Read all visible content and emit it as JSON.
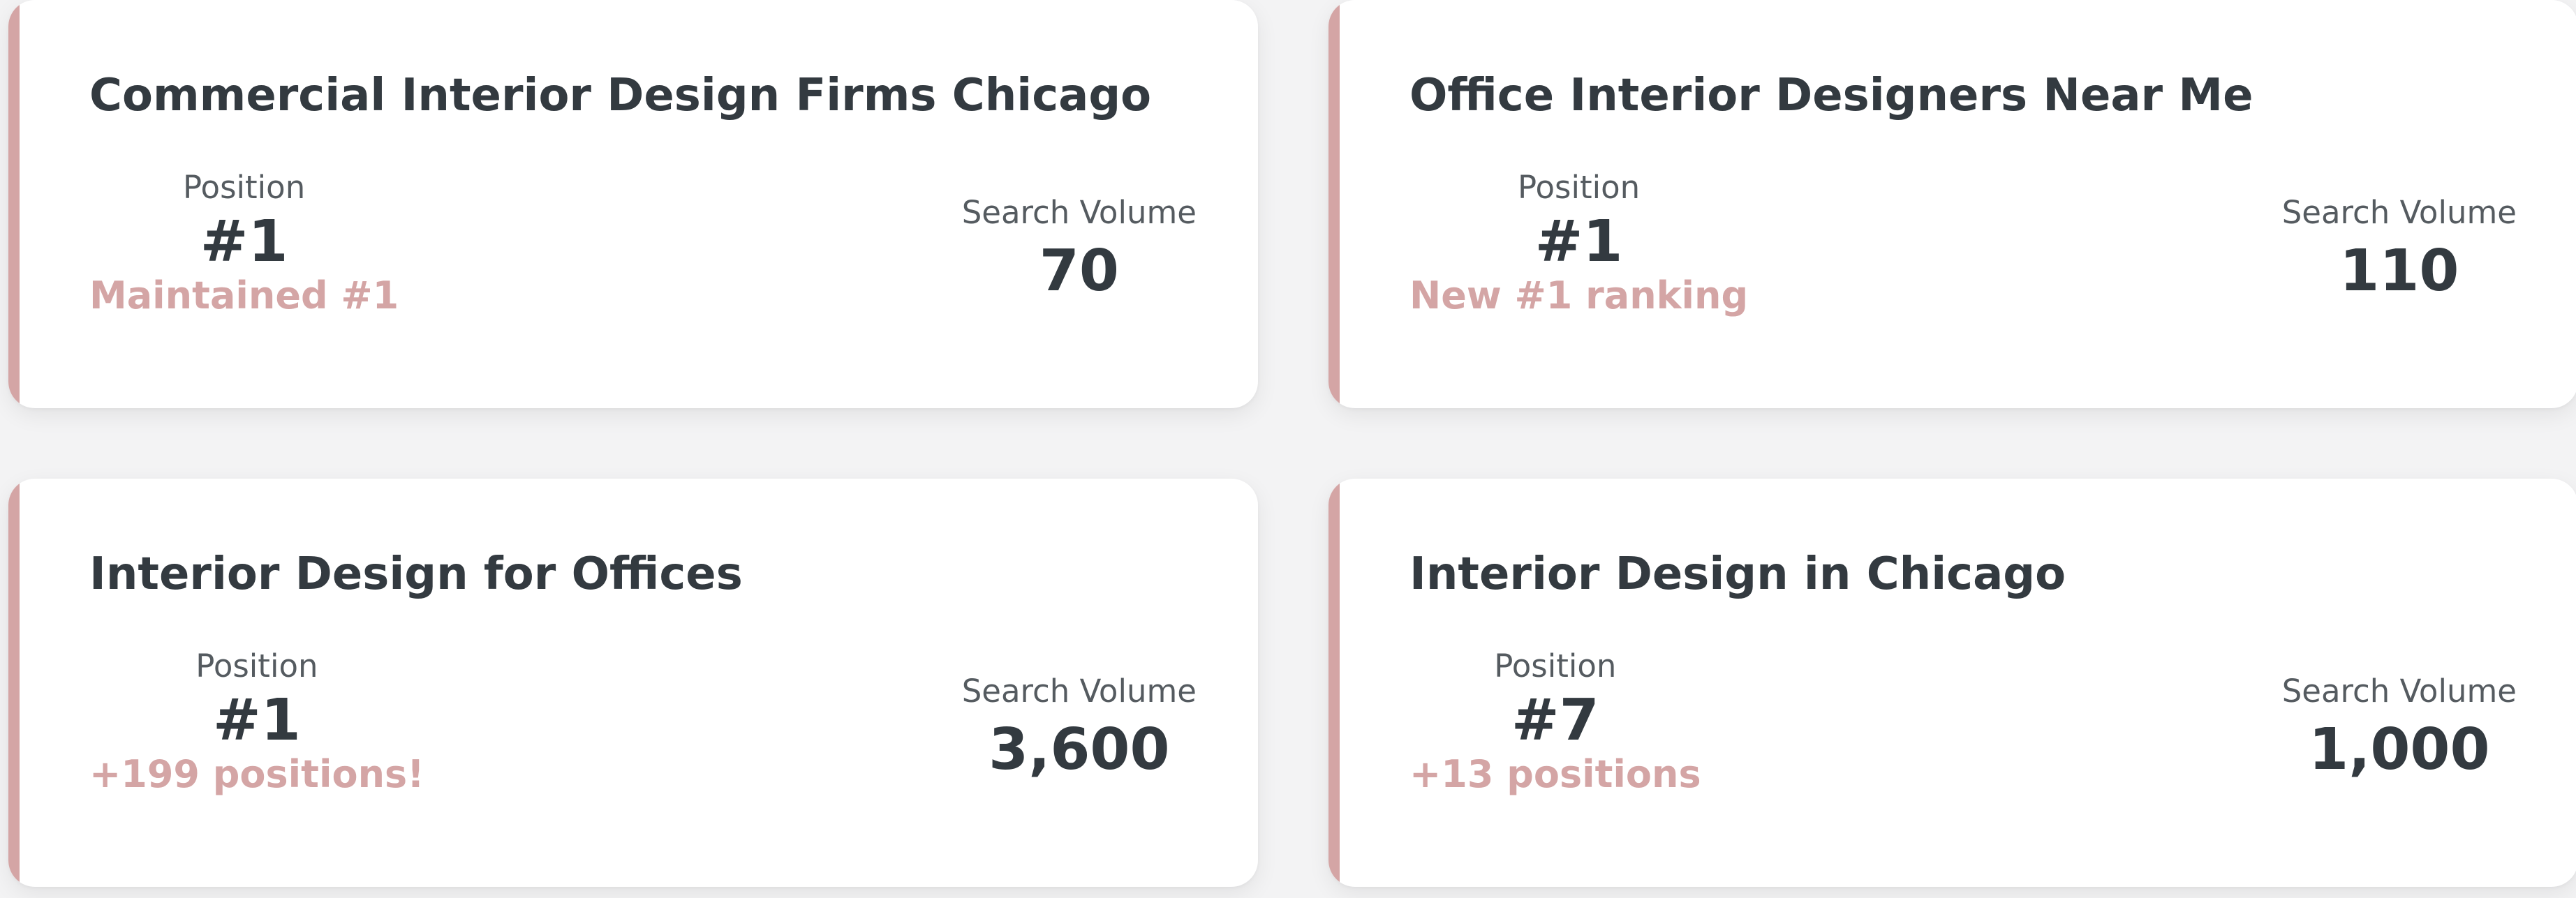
{
  "labels": {
    "position": "Position",
    "search_volume": "Search Volume"
  },
  "accent_color": "#d4a5a5",
  "cards": [
    {
      "title": "Commercial Interior Design Firms Chicago",
      "position": "#1",
      "change": "Maintained #1",
      "search_volume": "70"
    },
    {
      "title": "Office Interior Designers Near Me",
      "position": "#1",
      "change": "New #1 ranking",
      "search_volume": "110"
    },
    {
      "title": "Interior Design for Offices",
      "position": "#1",
      "change": "+199 positions!",
      "search_volume": "3,600"
    },
    {
      "title": "Interior Design in Chicago",
      "position": "#7",
      "change": "+13 positions",
      "search_volume": "1,000"
    }
  ]
}
